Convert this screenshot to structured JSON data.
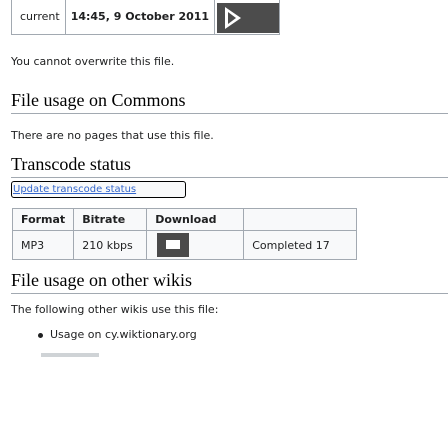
{
  "file_history": {
    "row_label": "current",
    "datetime": "14:45, 9 October 2011"
  },
  "overwrite_note": "You cannot overwrite this file.",
  "commons_usage": {
    "heading": "File usage on Commons",
    "text": "There are no pages that use this file."
  },
  "transcode": {
    "heading": "Transcode status",
    "update_button": "Update transcode status",
    "columns": [
      "Format",
      "Bitrate",
      "Download"
    ],
    "rows": [
      {
        "format": "MP3",
        "bitrate": "210 kbps",
        "download_icon": "download-icon",
        "status": "Completed 17"
      }
    ]
  },
  "other_wikis": {
    "heading": "File usage on other wikis",
    "text": "The following other wikis use this file:",
    "items": [
      "Usage on cy.wiktionary.org"
    ]
  }
}
